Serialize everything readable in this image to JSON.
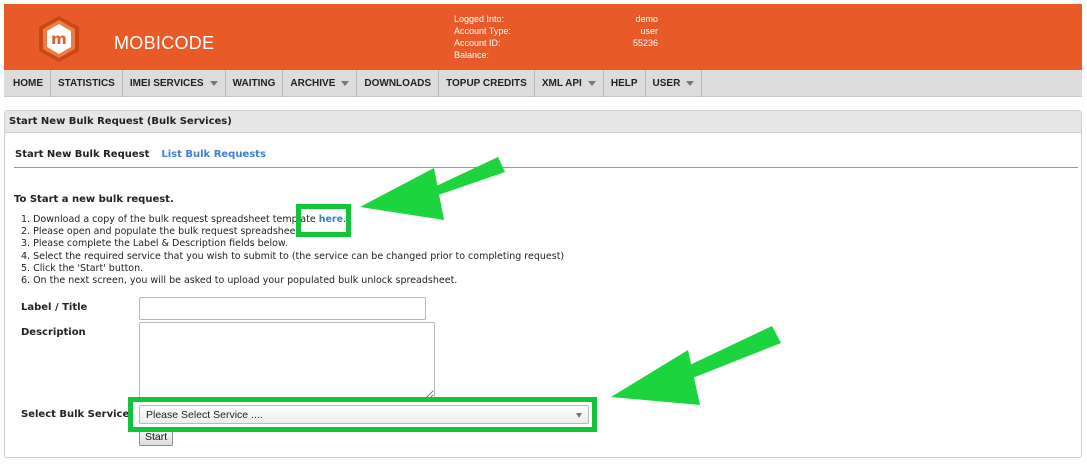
{
  "header": {
    "brand": "MOBICODE",
    "logo_letter": "m",
    "account_labels": [
      "Logged Into:",
      "Account Type:",
      "Account ID:",
      "Balance:"
    ],
    "account_values": [
      "demo",
      "user",
      "55236",
      ""
    ]
  },
  "nav": {
    "items": [
      {
        "label": "HOME",
        "dropdown": false
      },
      {
        "label": "STATISTICS",
        "dropdown": false
      },
      {
        "label": "IMEI SERVICES",
        "dropdown": true
      },
      {
        "label": "WAITING",
        "dropdown": false
      },
      {
        "label": "ARCHIVE",
        "dropdown": true
      },
      {
        "label": "DOWNLOADS",
        "dropdown": false
      },
      {
        "label": "TOPUP CREDITS",
        "dropdown": false
      },
      {
        "label": "XML API",
        "dropdown": true
      },
      {
        "label": "HELP",
        "dropdown": false
      },
      {
        "label": "USER",
        "dropdown": true
      }
    ]
  },
  "panel": {
    "title": "Start New Bulk Request (Bulk Services)",
    "tabs": [
      {
        "label": "Start New Bulk Request",
        "active": true
      },
      {
        "label": "List Bulk Requests",
        "active": false
      }
    ],
    "intro_title": "To Start a new bulk request.",
    "steps": [
      {
        "text": "1. Download a copy of the bulk request spreadsheet template ",
        "link": "here",
        "suffix": "."
      },
      {
        "text": "2. Please open and populate the bulk request spreadsheet."
      },
      {
        "text": "3. Please complete the Label & Description fields below."
      },
      {
        "text": "4. Select the required service that you wish to submit to (the service can be changed prior to completing request)"
      },
      {
        "text": "5. Click the 'Start' button."
      },
      {
        "text": "6. On the next screen, you will be asked to upload your populated bulk unlock spreadsheet."
      }
    ],
    "form": {
      "label_title": "Label / Title",
      "label_title_value": "",
      "description": "Description",
      "description_value": "",
      "select_label": "Select Bulk Service",
      "select_value": "Please Select Service ....",
      "start_button": "Start"
    }
  },
  "colors": {
    "header_bg": "#e85a27",
    "link": "#3d7fd6",
    "highlight": "#12c437"
  }
}
